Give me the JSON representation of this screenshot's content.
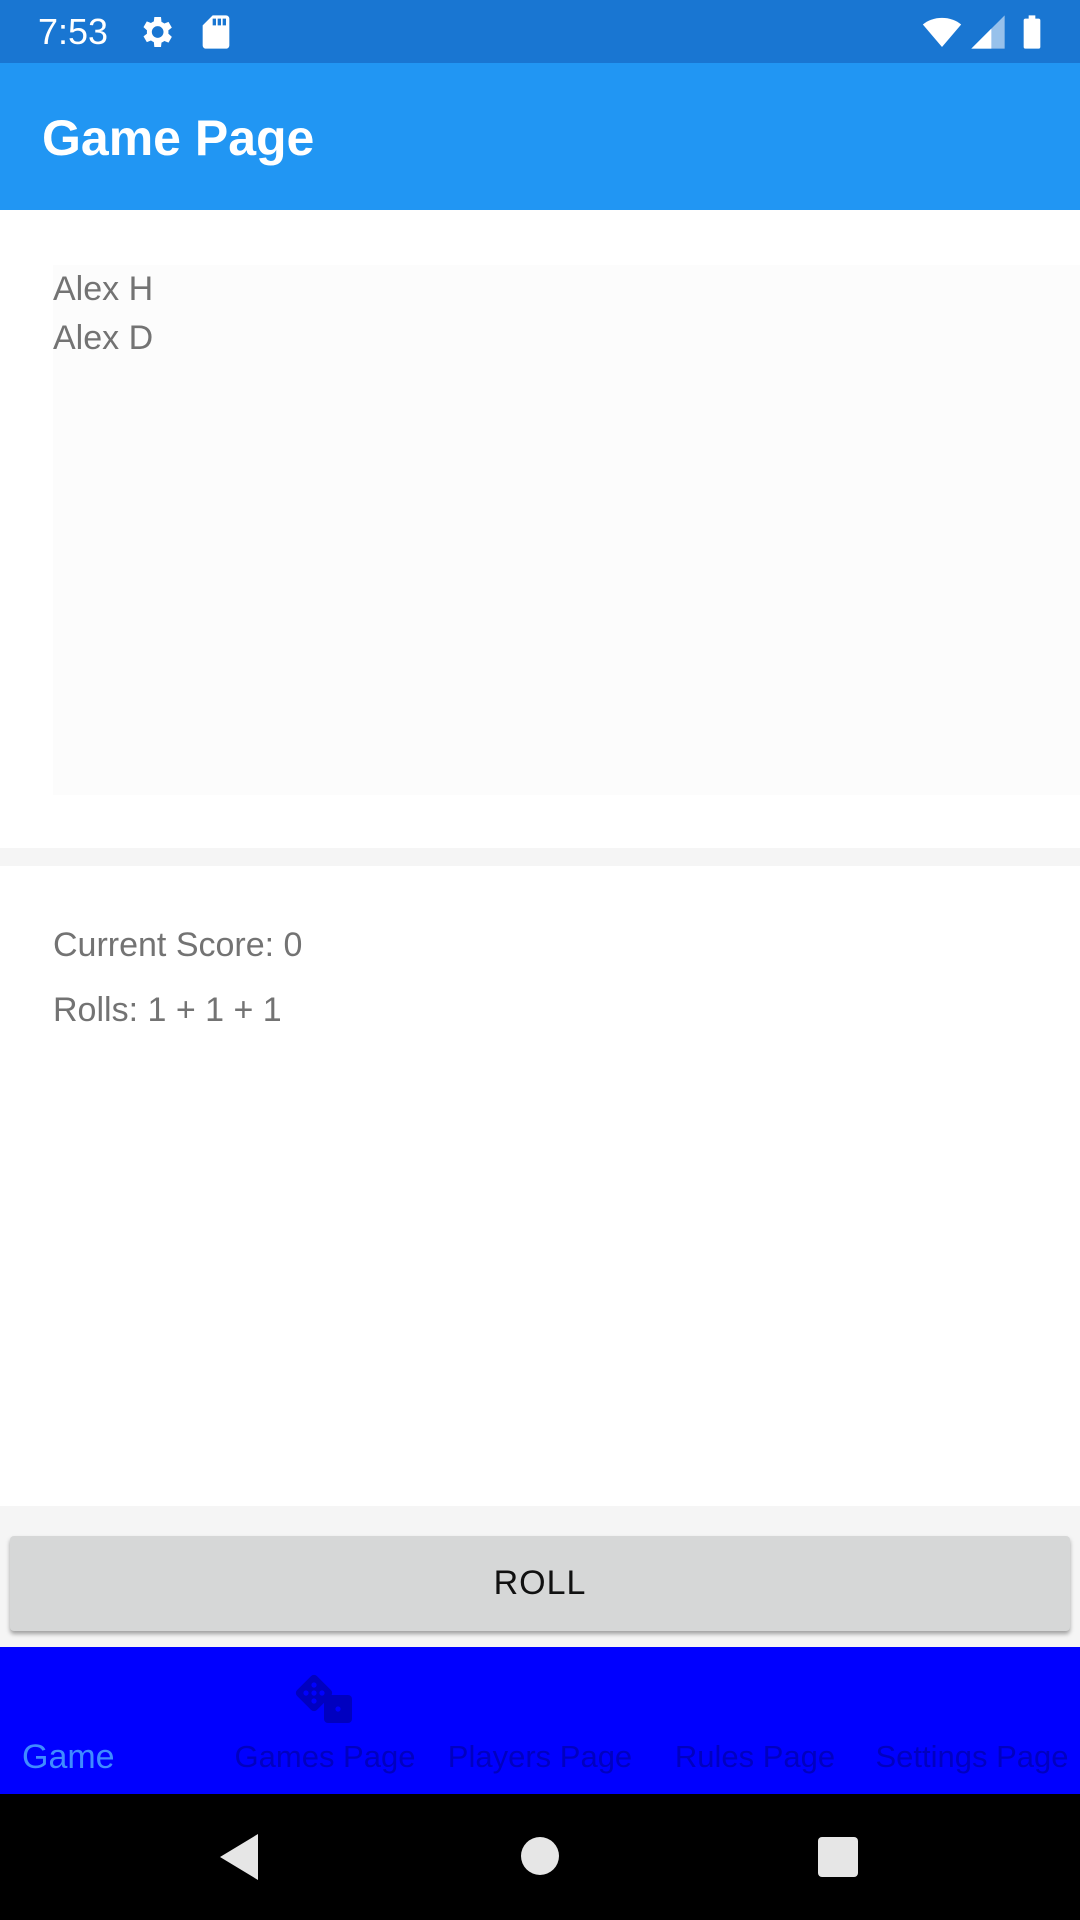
{
  "status_bar": {
    "time": "7:53",
    "icons": [
      "gear-icon",
      "sd-card-icon",
      "wifi-icon",
      "signal-icon",
      "battery-icon"
    ]
  },
  "app_bar": {
    "title": "Game Page"
  },
  "players": {
    "items": [
      "Alex H",
      "Alex D"
    ]
  },
  "score": {
    "current_score": "Current Score: 0",
    "rolls": "Rolls: 1 + 1 + 1"
  },
  "roll_button": {
    "label": "ROLL"
  },
  "tab_bar": {
    "tabs": [
      {
        "label": "Game",
        "active": true
      },
      {
        "label": "Games Page",
        "icon": "dice-icon"
      },
      {
        "label": "Players Page"
      },
      {
        "label": "Rules Page"
      },
      {
        "label": "Settings Page"
      }
    ]
  },
  "nav_bar": {
    "icons": [
      "back-icon",
      "home-icon",
      "recents-icon"
    ]
  },
  "colors": {
    "status_bar": "#1976d2",
    "app_bar": "#2196f3",
    "tab_bar": "#0000ff",
    "active_tab": "#3f8cff"
  }
}
